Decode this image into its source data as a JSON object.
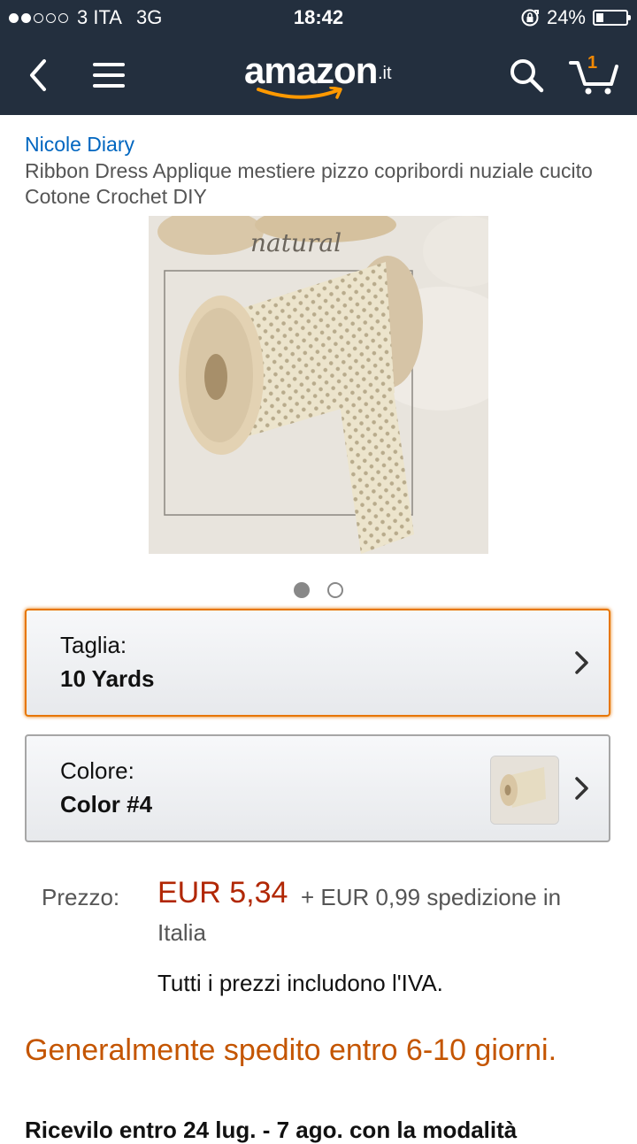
{
  "status": {
    "carrier": "3 ITA",
    "network": "3G",
    "time": "18:42",
    "battery": "24%",
    "battery_level": 0.24
  },
  "nav": {
    "logo_text": "amazon",
    "logo_tld": ".it",
    "cart_count": "1"
  },
  "product": {
    "brand": "Nicole Diary",
    "title": "Ribbon Dress Applique mestiere pizzo copribordi nuziale cucito Cotone Crochet DIY",
    "image_caption": "natural"
  },
  "carousel": {
    "count": 2,
    "active_index": 0
  },
  "variations": {
    "size_label": "Taglia:",
    "size_value": "10 Yards",
    "color_label": "Colore:",
    "color_value": "Color #4"
  },
  "pricing": {
    "label": "Prezzo:",
    "price": "EUR 5,34",
    "shipping_line1": "+ EUR 0,99 spedizione in",
    "shipping_line2": "Italia",
    "vat_note": "Tutti i prezzi includono l'IVA."
  },
  "availability": {
    "text": "Generalmente spedito entro 6-10 giorni.",
    "receive_text": "Ricevilo entro 24 lug. - 7 ago. con la modalità"
  },
  "colors": {
    "header_bg": "#232f3e",
    "accent_orange": "#e77600",
    "price_red": "#b12704",
    "availability_orange": "#c45500",
    "brand_link": "#0066c0"
  }
}
